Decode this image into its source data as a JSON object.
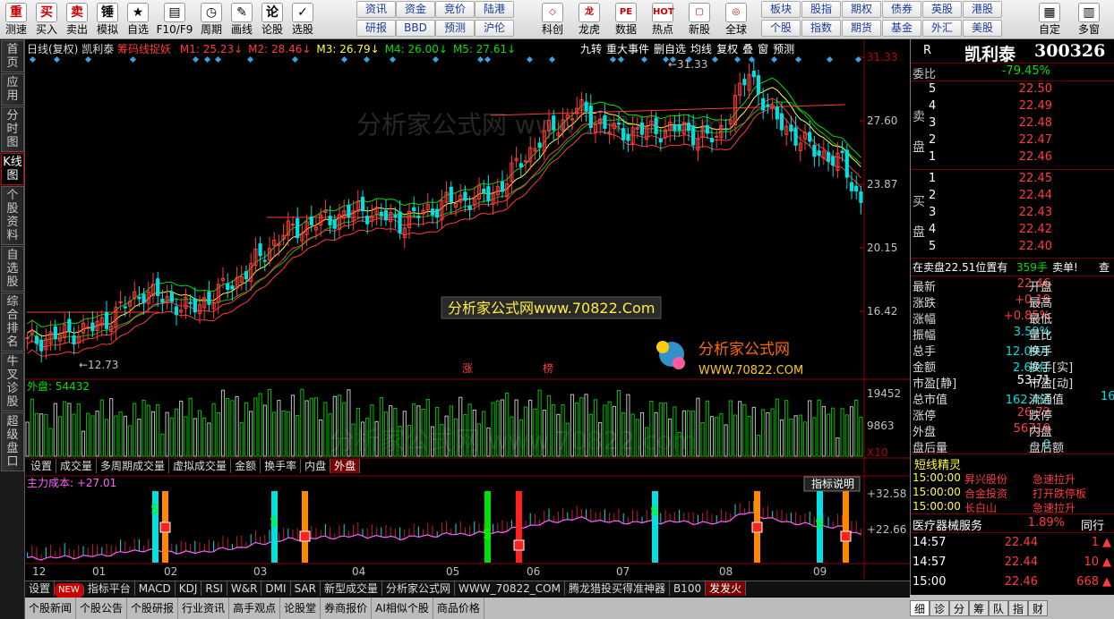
{
  "toolbar": {
    "left_buttons": [
      {
        "icon": "重",
        "label": "测速"
      },
      {
        "icon": "买",
        "label": "买入"
      },
      {
        "icon": "卖",
        "label": "卖出"
      },
      {
        "icon": "锤",
        "label": "模拟"
      },
      {
        "icon": "★",
        "label": "自选"
      },
      {
        "icon": "▤",
        "label": "F10/F9"
      },
      {
        "icon": "◷",
        "label": "周期"
      },
      {
        "icon": "✎",
        "label": "画线"
      },
      {
        "icon": "论",
        "label": "论股"
      },
      {
        "icon": "✓",
        "label": "选股"
      }
    ],
    "quick_grid": [
      [
        "资讯",
        "资金",
        "竞价",
        "陆港"
      ],
      [
        "研报",
        "BBD",
        "预测",
        "沪伦"
      ]
    ],
    "mid_buttons": [
      {
        "icon": "◇",
        "label": "科创"
      },
      {
        "icon": "龙",
        "label": "龙虎"
      },
      {
        "icon": "PE",
        "label": "数据"
      },
      {
        "icon": "HOT",
        "label": "热点"
      },
      {
        "icon": "▢",
        "label": "新股"
      },
      {
        "icon": "◎",
        "label": "全球"
      }
    ],
    "quick_grid2": [
      [
        "板块",
        "股指",
        "期权",
        "债券",
        "英股",
        "港股"
      ],
      [
        "个股",
        "指数",
        "期货",
        "基金",
        "外汇",
        "美股"
      ]
    ],
    "right_buttons": [
      {
        "icon": "▦",
        "label": "自定"
      },
      {
        "icon": "▥",
        "label": "多窗"
      }
    ]
  },
  "sidebar": [
    "首页",
    "应用",
    "分时图",
    "K线图",
    "个股资料",
    "自选股",
    "综合排名",
    "牛叉诊股",
    "超级盘口"
  ],
  "chart": {
    "info": {
      "period": "日线(复权)",
      "name": "凯利泰",
      "indicator": "筹码线捉妖",
      "ma": [
        {
          "label": "M1: 25.23",
          "color": "#ff3b3b",
          "arrow": "↓"
        },
        {
          "label": "M2: 28.46",
          "color": "#ff3b3b",
          "arrow": "↓"
        },
        {
          "label": "M3: 26.79",
          "color": "#ffff40",
          "arrow": "↓"
        },
        {
          "label": "M4: 26.00",
          "color": "#00e000",
          "arrow": "↓"
        },
        {
          "label": "M5: 27.61",
          "color": "#00e000",
          "arrow": "↓"
        }
      ]
    },
    "menu": [
      "九转",
      "重大事件",
      "删自选",
      "均线",
      "复权",
      "叠",
      "窗",
      "预测"
    ],
    "price_ticks": [
      "31.33",
      "27.60",
      "23.87",
      "20.15",
      "16.42"
    ],
    "high_label": "31.33",
    "low_label": "12.73",
    "markers": [
      "涨",
      "榜"
    ],
    "volume": {
      "label": "外盘: 54432",
      "ticks": [
        "19452",
        "9863",
        "X10"
      ]
    },
    "indicator_tabs": [
      "设置",
      "成交量",
      "多周期成交量",
      "虚拟成交量",
      "金额",
      "换手率",
      "内盘",
      "外盘"
    ],
    "cost": {
      "label": "主力成本: +27.01",
      "ticks": [
        "+32.58",
        "+22.66"
      ],
      "explain": "指标说明"
    },
    "months": [
      "12",
      "01",
      "02",
      "03",
      "04",
      "05",
      "06",
      "07",
      "08",
      "09"
    ],
    "bottom_tabs": [
      "设置",
      "NEW",
      "指标平台",
      "MACD",
      "KDJ",
      "RSI",
      "W&R",
      "DMI",
      "SAR",
      "新型成交量",
      "分析家公式网",
      "WWW_70822_COM",
      "腾龙猎投买得准神器",
      "B100",
      "发发火"
    ],
    "news_tabs": [
      "个股新闻",
      "个股公告",
      "个股研报",
      "行业资讯",
      "高手观点",
      "论股堂",
      "券商报价",
      "AI相似个股",
      "商品价格"
    ],
    "watermark_text": "分析家公式网www.70822.Com",
    "logo_title": "分析家公式网",
    "logo_url": "WWW.70822.COM",
    "faint_watermark": "分析家公式网 www.70822.com"
  },
  "quote": {
    "flag": "R",
    "name": "凯利泰",
    "code": "300326",
    "weibi_label": "委比",
    "weibi_value": "-79.45%",
    "sell_label": "卖盘",
    "buy_label": "买盘",
    "sell": [
      {
        "lvl": "5",
        "price": "22.50",
        "vol": ""
      },
      {
        "lvl": "4",
        "price": "22.49",
        "vol": ""
      },
      {
        "lvl": "3",
        "price": "22.48",
        "vol": ""
      },
      {
        "lvl": "2",
        "price": "22.47",
        "vol": ""
      },
      {
        "lvl": "1",
        "price": "22.46",
        "vol": ""
      }
    ],
    "buy": [
      {
        "lvl": "1",
        "price": "22.45",
        "vol": ""
      },
      {
        "lvl": "2",
        "price": "22.44",
        "vol": ""
      },
      {
        "lvl": "3",
        "price": "22.43",
        "vol": ""
      },
      {
        "lvl": "4",
        "price": "22.42",
        "vol": ""
      },
      {
        "lvl": "5",
        "price": "22.40",
        "vol": ""
      }
    ],
    "notice_prefix": "在卖盘22.51位置有",
    "notice_vol": "359手",
    "notice_suffix": "卖单!",
    "notice_link": "查",
    "stats": [
      {
        "l": "最新",
        "v": "22.46",
        "c": "red",
        "l2": "开盘"
      },
      {
        "l": "涨跌",
        "v": "+0.19",
        "c": "red",
        "l2": "最高"
      },
      {
        "l": "涨幅",
        "v": "+0.85%",
        "c": "red",
        "l2": "最低"
      },
      {
        "l": "振幅",
        "v": "3.59%",
        "c": "cyan",
        "l2": "量比"
      },
      {
        "l": "总手",
        "v": "12.09万",
        "c": "cyan",
        "l2": "换手"
      },
      {
        "l": "金额",
        "v": "2.68亿",
        "c": "cyan",
        "l2": "换手[实]"
      },
      {
        "l": "市盈[静]",
        "v": "53.71",
        "c": "wht",
        "l2": "市盈[动]"
      },
      {
        "l": "总市值",
        "v": "162.4亿",
        "c": "cyan",
        "l2": "流通值",
        "v2": "16"
      },
      {
        "l": "涨停",
        "v": "26.72",
        "c": "red",
        "l2": "跌停"
      },
      {
        "l": "外盘",
        "v": "56719",
        "c": "red",
        "l2": "内盘"
      },
      {
        "l": "盘后量",
        "v": "0",
        "c": "cyan",
        "l2": "盘后额"
      }
    ],
    "sprite_title": "短线精灵",
    "sprites": [
      {
        "t": "15:00:00",
        "n": "昇兴股份",
        "e": "急速拉升"
      },
      {
        "t": "15:00:00",
        "n": "合金投资",
        "e": "打开跌停板"
      },
      {
        "t": "15:00:00",
        "n": "长白山",
        "e": "急速拉升"
      }
    ],
    "sector": {
      "name": "医疗器械服务",
      "pct": "1.89%",
      "more": "同行"
    },
    "ticks": [
      {
        "t": "14:57",
        "p": "22.44",
        "v": "1",
        "d": "▲"
      },
      {
        "t": "14:57",
        "p": "22.44",
        "v": "10",
        "d": "▲"
      },
      {
        "t": "15:00",
        "p": "22.46",
        "v": "668",
        "d": "▲"
      }
    ],
    "bottom_tabs": [
      "细",
      "诊",
      "分",
      "筹",
      "队",
      "指",
      "财"
    ]
  },
  "colors": {
    "up": "#ff3b3b",
    "down": "#00e0e0",
    "bg": "#000000",
    "grid": "#6a0000"
  }
}
